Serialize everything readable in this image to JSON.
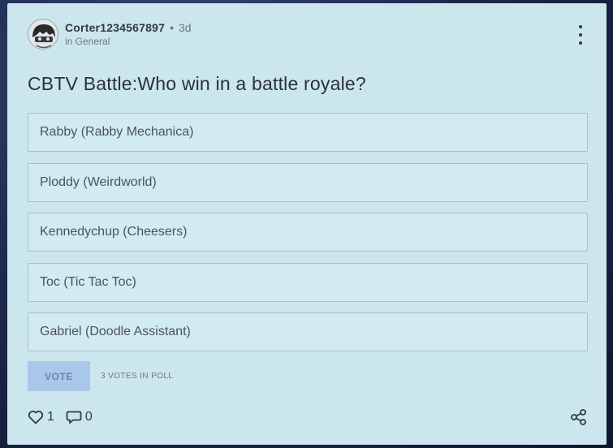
{
  "post": {
    "author": "Corter1234567897",
    "separator": "•",
    "age": "3d",
    "category": "in General",
    "title": "CBTV Battle:Who win in a battle royale?"
  },
  "poll": {
    "options": [
      "Rabby (Rabby Mechanica)",
      "Ploddy (Weirdworld)",
      "Kennedychup (Cheesers)",
      "Toc (Tic Tac Toc)",
      "Gabriel (Doodle Assistant)"
    ],
    "vote_label": "VOTE",
    "votes_text": "3 VOTES IN POLL"
  },
  "footer": {
    "likes": "1",
    "comments": "0"
  },
  "icons": {
    "menu": "kebab-menu-icon",
    "like": "heart-icon",
    "comment": "comment-icon",
    "share": "share-icon"
  },
  "colors": {
    "card_bg": "#cce6ee",
    "vote_button": "#a9c7e8"
  }
}
